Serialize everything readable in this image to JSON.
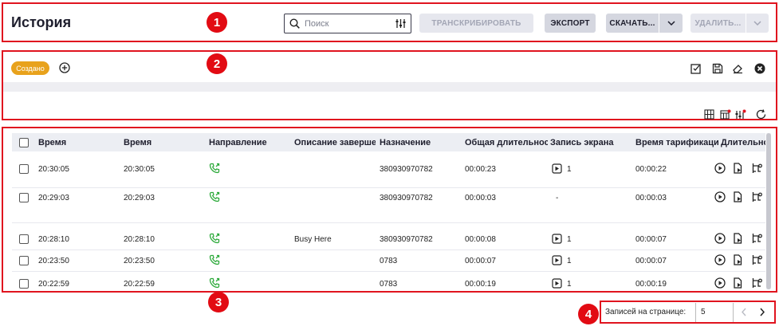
{
  "header": {
    "title": "История",
    "search_placeholder": "Поиск",
    "transcribe_label": "ТРАНСКРИБИРОВАТЬ",
    "export_label": "ЭКСПОРТ",
    "download_label": "СКАЧАТЬ...",
    "delete_label": "УДАЛИТЬ..."
  },
  "filters": {
    "chip_label": "Создано"
  },
  "badges": [
    "1",
    "2",
    "3",
    "4"
  ],
  "table": {
    "columns": [
      "Время",
      "Время",
      "Направление",
      "Описание заверше",
      "Назначение",
      "Общая длительнос",
      "Запись экрана",
      "Время тарификаци",
      "Длительно"
    ],
    "rows": [
      {
        "time1": "20:30:05",
        "time2": "20:30:05",
        "desc": "",
        "dest": "380930970782",
        "total": "00:00:23",
        "rec": "1",
        "billing": "00:00:22"
      },
      {
        "time1": "20:29:03",
        "time2": "20:29:03",
        "desc": "",
        "dest": "380930970782",
        "total": "00:00:03",
        "rec": "-",
        "billing": "00:00:03"
      },
      {
        "time1": "20:28:10",
        "time2": "20:28:10",
        "desc": "Busy Here",
        "dest": "380930970782",
        "total": "00:00:08",
        "rec": "1",
        "billing": "00:00:07"
      },
      {
        "time1": "20:23:50",
        "time2": "20:23:50",
        "desc": "",
        "dest": "0783",
        "total": "00:00:07",
        "rec": "1",
        "billing": "00:00:07"
      },
      {
        "time1": "20:22:59",
        "time2": "20:22:59",
        "desc": "",
        "dest": "0783",
        "total": "00:00:19",
        "rec": "1",
        "billing": "00:00:19"
      }
    ]
  },
  "pager": {
    "label": "Записей на странице:",
    "page_size": "5"
  },
  "colors": {
    "accent_red": "#e0141f",
    "chip_orange": "#e8a21c",
    "call_green": "#2eaa3c"
  }
}
